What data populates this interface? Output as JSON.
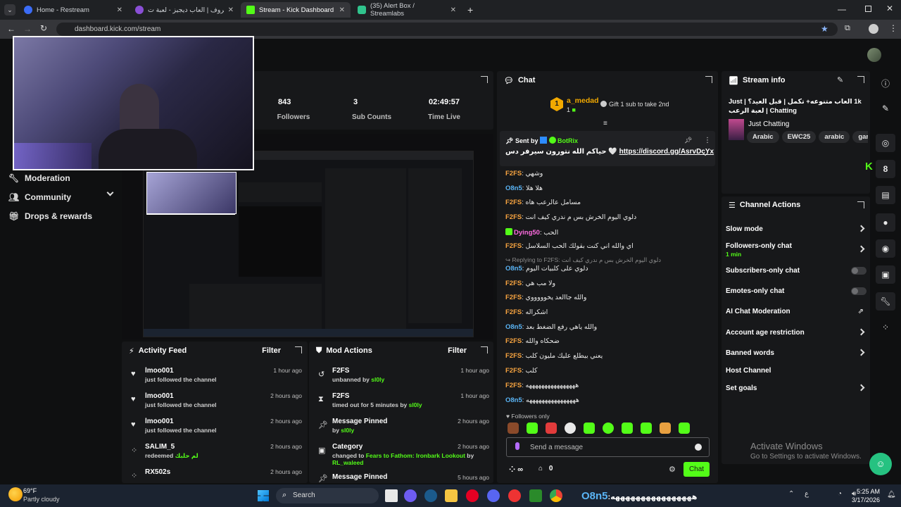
{
  "browser": {
    "tabs": [
      {
        "title": "Home - Restream",
        "color": "#3b6cf6"
      },
      {
        "title": "لعبة حروف | العاب ديجيز - لعبة ت",
        "color": "#8a4fd6"
      },
      {
        "title": "Stream - Kick Dashboard",
        "color": "#53fc18"
      },
      {
        "title": "(35) Alert Box / Streamlabs",
        "color": "#30c48d"
      }
    ],
    "url": "dashboard.kick.com/stream"
  },
  "sidebar": {
    "items": [
      {
        "label": "Moderation",
        "icon": "wrench-icon"
      },
      {
        "label": "Community",
        "icon": "people-icon"
      },
      {
        "label": "Drops & rewards",
        "icon": "gift-icon"
      }
    ]
  },
  "stats": [
    {
      "value": "843",
      "label": "Followers"
    },
    {
      "value": "3",
      "label": "Sub Counts"
    },
    {
      "value": "02:49:57",
      "label": "Time Live"
    }
  ],
  "activity_feed": {
    "title": "Activity Feed",
    "filter": "Filter",
    "items": [
      {
        "user": "lmoo001",
        "text": "just followed the channel",
        "time": "1 hour ago",
        "icon": "heart-icon"
      },
      {
        "user": "lmoo001",
        "text": "just followed the channel",
        "time": "2 hours ago",
        "icon": "heart-icon"
      },
      {
        "user": "lmoo001",
        "text": "just followed the channel",
        "time": "2 hours ago",
        "icon": "heart-icon"
      },
      {
        "user": "SALIM_5",
        "text": "redeemed",
        "extra": "لم حلبك",
        "time": "2 hours ago",
        "icon": "points-icon"
      },
      {
        "user": "RX502s",
        "text": "",
        "time": "2 hours ago",
        "icon": "points-icon"
      }
    ]
  },
  "mod_actions": {
    "title": "Mod Actions",
    "filter": "Filter",
    "items": [
      {
        "title": "F2FS",
        "text": "unbanned by",
        "by": "sl0ly",
        "time": "1 hour ago",
        "icon": "undo-icon"
      },
      {
        "title": "F2FS",
        "text": "timed out for 5 minutes by",
        "by": "sl0ly",
        "time": "1 hour ago",
        "icon": "hourglass-icon"
      },
      {
        "title": "Message Pinned",
        "text": "by",
        "by": "sl0ly",
        "time": "2 hours ago",
        "icon": "pin-icon"
      },
      {
        "title": "Category",
        "text": "changed to",
        "by": "Fears to Fathom: Ironbark Lookout",
        "by2": "by",
        "by3": "RL_waleed",
        "time": "2 hours ago",
        "icon": "category-icon"
      },
      {
        "title": "Message Pinned",
        "text": "",
        "by": "",
        "time": "5 hours ago",
        "icon": "pin-icon"
      }
    ]
  },
  "chat": {
    "title": "Chat",
    "top_gifter": {
      "name": "a_medad",
      "rank": "1",
      "count": "1"
    },
    "gift_text": "Gift 1 sub to take 2nd",
    "pinned": {
      "sent_by": "Sent by",
      "user": "BotRix",
      "message": "حياكم الله نتورون سيرفر دس 🤍",
      "link": "https://discord.gg/AsrvDcYx"
    },
    "reply": {
      "label": "Replying to F2FS:",
      "quote": "دلوي اليوم الخرش بس م ندري كيف انت"
    },
    "messages": [
      {
        "user": "F2FS",
        "text": "وشهي",
        "color": "#f7a440"
      },
      {
        "user": "O8n5",
        "text": "هلا هلا",
        "color": "#5ab4f5"
      },
      {
        "user": "F2FS",
        "text": "مسامل عالرعب هاه",
        "color": "#f7a440"
      },
      {
        "user": "F2FS",
        "text": "دلوي اليوم الخرش بس م ندري كيف انت",
        "color": "#f7a440"
      },
      {
        "user": "Dying50",
        "text": "الحب",
        "color": "#ff6be0"
      },
      {
        "user": "F2FS",
        "text": "اي والله اني كنت بقولك الحب السلاسل",
        "color": "#f7a440"
      },
      {
        "user": "O8n5",
        "text": "دلوي على كلبيات اليوم",
        "color": "#5ab4f5"
      },
      {
        "user": "F2FS",
        "text": "ولا مب هي",
        "color": "#f7a440"
      },
      {
        "user": "F2FS",
        "text": "والله جاالعد يخوووووي",
        "color": "#f7a440"
      },
      {
        "user": "F2FS",
        "text": "اشكراله",
        "color": "#f7a440"
      },
      {
        "user": "O8n5",
        "text": "والله ياهي رفع الضغط بعد",
        "color": "#5ab4f5"
      },
      {
        "user": "F2FS",
        "text": "ضحكاه والله",
        "color": "#f7a440"
      },
      {
        "user": "F2FS",
        "text": "يعني بيطلع عليك مليون كلب",
        "color": "#f7a440"
      },
      {
        "user": "F2FS",
        "text": "كلب",
        "color": "#f7a440"
      },
      {
        "user": "F2FS",
        "text": "ههههههههههههههههه",
        "color": "#f7a440"
      },
      {
        "user": "O8n5",
        "text": "ههههههههههههههههه",
        "color": "#5ab4f5"
      }
    ],
    "mode": "Followers only",
    "input_placeholder": "Send a message",
    "points": "∞",
    "store_count": "0",
    "send_label": "Chat"
  },
  "stream_info": {
    "title": "Stream info",
    "stream_title": "1k العاب متنوعه+ تكمل | قبل العيد؟ | Just Chatting | لعبة الرعب",
    "category": "Just Chatting",
    "tags": [
      "Arabic",
      "EWC25",
      "arabic",
      "gam"
    ]
  },
  "channel_actions": {
    "title": "Channel Actions",
    "items": [
      {
        "label": "Slow mode",
        "control": "chevron"
      },
      {
        "label": "Followers-only chat",
        "sub": "1 min",
        "control": "chevron"
      },
      {
        "label": "Subscribers-only chat",
        "control": "toggle"
      },
      {
        "label": "Emotes-only chat",
        "control": "toggle"
      },
      {
        "label": "AI Chat Moderation",
        "control": "external"
      },
      {
        "label": "Account age restriction",
        "control": "chevron"
      },
      {
        "label": "Banned words",
        "control": "chevron"
      },
      {
        "label": "Host Channel",
        "control": "none"
      },
      {
        "label": "Set goals",
        "control": "chevron"
      }
    ]
  },
  "watermark": {
    "line1": "Activate Windows",
    "line2": "Go to Settings to activate Windows."
  },
  "taskbar": {
    "weather_temp": "69°F",
    "weather_desc": "Partly cloudy",
    "search": "Search",
    "time": "5:25 AM",
    "date": "3/17/2026",
    "lang": "ع",
    "ticker_user": "O8n5",
    "ticker_text": ":ههههههههههههههههه"
  },
  "colors": {
    "kick_green": "#53fc18",
    "panel": "#17181a"
  }
}
